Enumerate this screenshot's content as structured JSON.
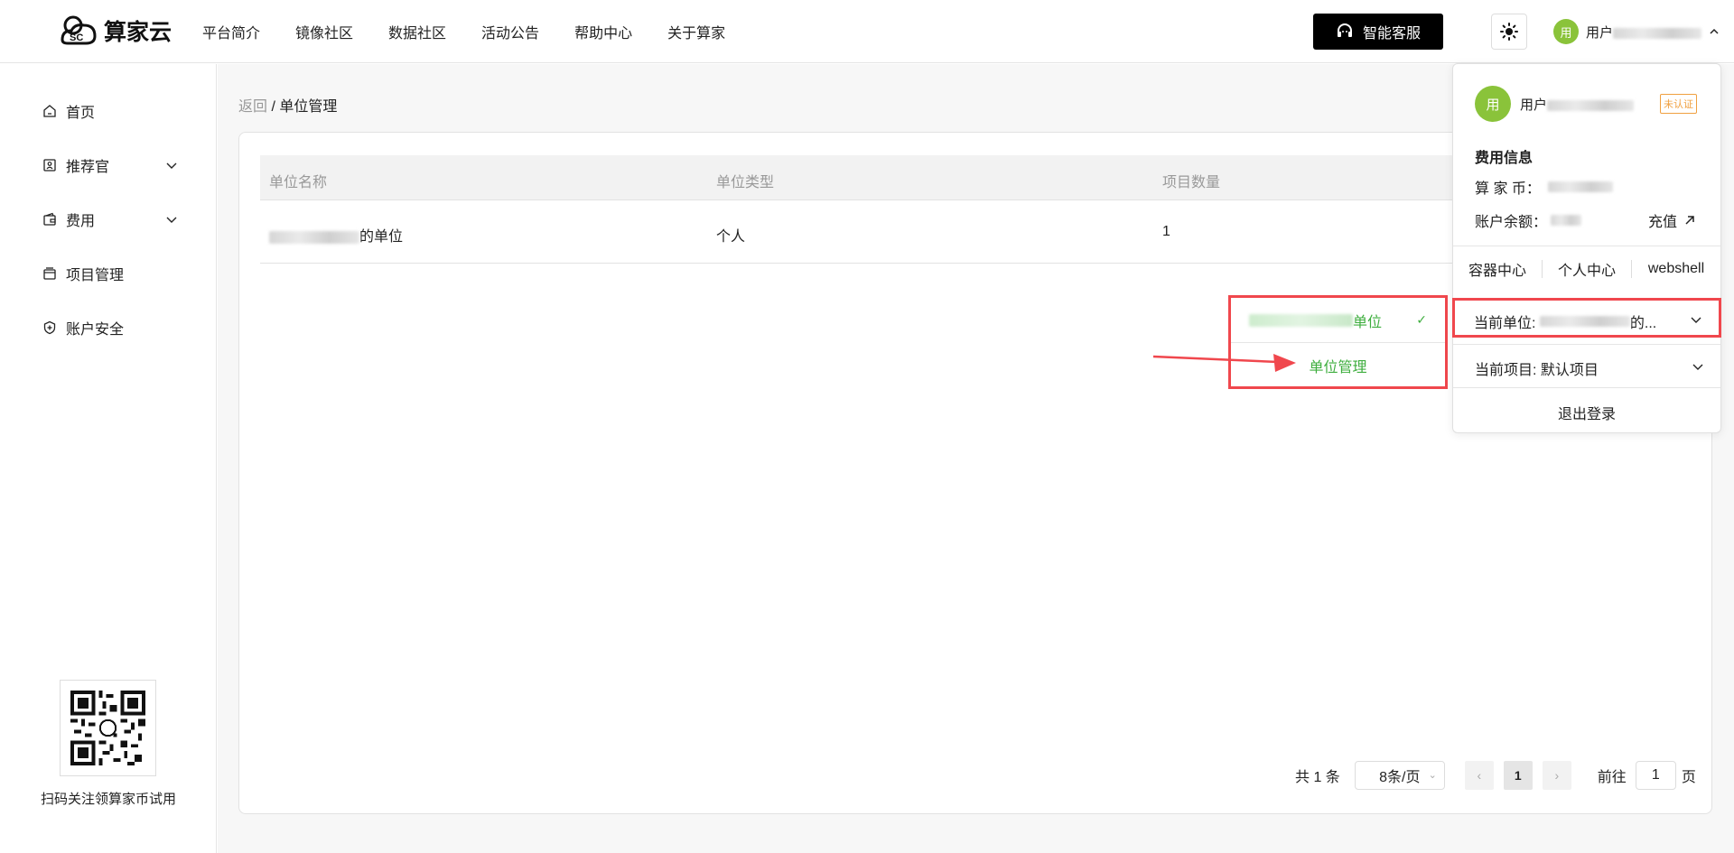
{
  "header": {
    "logo_text": "算家云",
    "nav": [
      "平台简介",
      "镜像社区",
      "数据社区",
      "活动公告",
      "帮助中心",
      "关于算家"
    ],
    "service_label": "智能客服",
    "avatar_char": "用",
    "user_prefix": "用户"
  },
  "sidebar": {
    "items": [
      {
        "label": "首页",
        "icon": "home-icon"
      },
      {
        "label": "推荐官",
        "icon": "badge-icon",
        "has_arrow": true
      },
      {
        "label": "费用",
        "icon": "wallet-icon",
        "has_arrow": true
      },
      {
        "label": "项目管理",
        "icon": "folder-icon"
      },
      {
        "label": "账户安全",
        "icon": "shield-icon"
      }
    ],
    "qr_caption": "扫码关注领算家币试用"
  },
  "breadcrumb": {
    "back": "返回",
    "separator": " / ",
    "current": "单位管理"
  },
  "table": {
    "headers": [
      "单位名称",
      "单位类型",
      "项目数量"
    ],
    "rows": [
      {
        "name_suffix": "的单位",
        "type": "个人",
        "count": "1"
      }
    ]
  },
  "pagination": {
    "total": "共 1 条",
    "page_size": "8条/页",
    "current": "1",
    "goto_label": "前往",
    "goto_value": "1",
    "page_unit": "页"
  },
  "unit_dropdown": {
    "selected_suffix": "单位",
    "manage_label": "单位管理"
  },
  "user_panel": {
    "avatar_char": "用",
    "name_prefix": "用户",
    "status_badge": "未认证",
    "fee_title": "费用信息",
    "coin_label": "算 家 币：",
    "balance_label": "账户余额：",
    "recharge_label": "充值",
    "links": [
      "容器中心",
      "个人中心",
      "webshell"
    ],
    "current_unit_label": "当前单位:",
    "current_unit_suffix": "的...",
    "current_project_label": "当前项目:",
    "current_project_value": "默认项目",
    "logout_label": "退出登录"
  },
  "colors": {
    "accent_green": "#3eae3e",
    "avatar_green": "#8ac33a",
    "highlight_red": "#f0474d",
    "badge_orange": "#f0a040"
  }
}
